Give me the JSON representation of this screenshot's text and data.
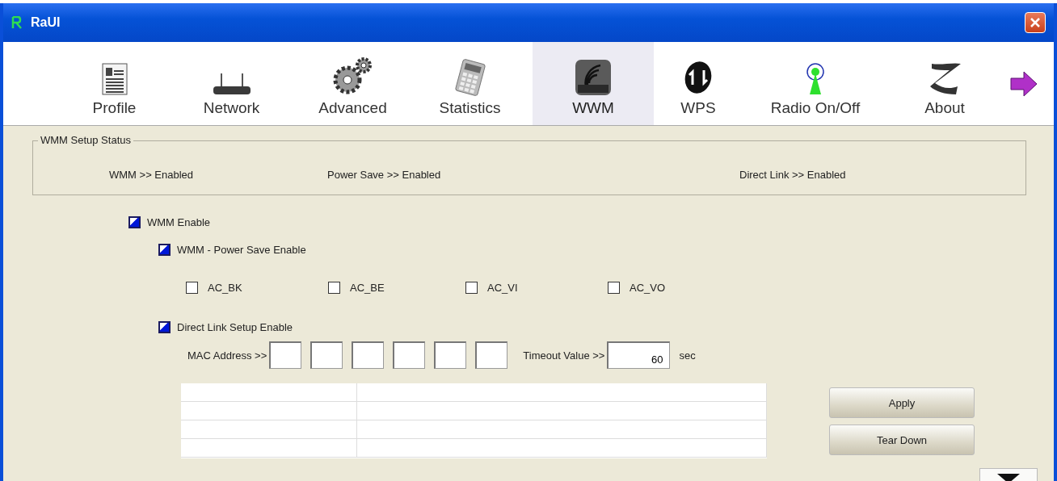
{
  "window": {
    "title": "RaUI"
  },
  "tabs": [
    {
      "label": "Profile",
      "selected": false
    },
    {
      "label": "Network",
      "selected": false
    },
    {
      "label": "Advanced",
      "selected": false
    },
    {
      "label": "Statistics",
      "selected": false
    },
    {
      "label": "WWM",
      "selected": true
    },
    {
      "label": "WPS",
      "selected": false
    },
    {
      "label": "Radio On/Off",
      "selected": false
    },
    {
      "label": "About",
      "selected": false
    }
  ],
  "status_group": {
    "title": "WMM Setup Status",
    "items": [
      "WMM >> Enabled",
      "Power Save >> Enabled",
      "Direct Link >> Enabled"
    ]
  },
  "wmm_enable": {
    "label": "WMM Enable",
    "checked": true
  },
  "power_save_enable": {
    "label": "WMM - Power Save Enable",
    "checked": true
  },
  "access_categories": [
    {
      "label": "AC_BK",
      "checked": false
    },
    {
      "label": "AC_BE",
      "checked": false
    },
    {
      "label": "AC_VI",
      "checked": false
    },
    {
      "label": "AC_VO",
      "checked": false
    }
  ],
  "direct_link_enable": {
    "label": "Direct Link Setup Enable",
    "checked": true
  },
  "mac_address": {
    "label": "MAC Address >>"
  },
  "timeout": {
    "label": "Timeout Value >>",
    "value": "60",
    "unit": "sec"
  },
  "buttons": [
    "Apply",
    "Tear Down"
  ]
}
